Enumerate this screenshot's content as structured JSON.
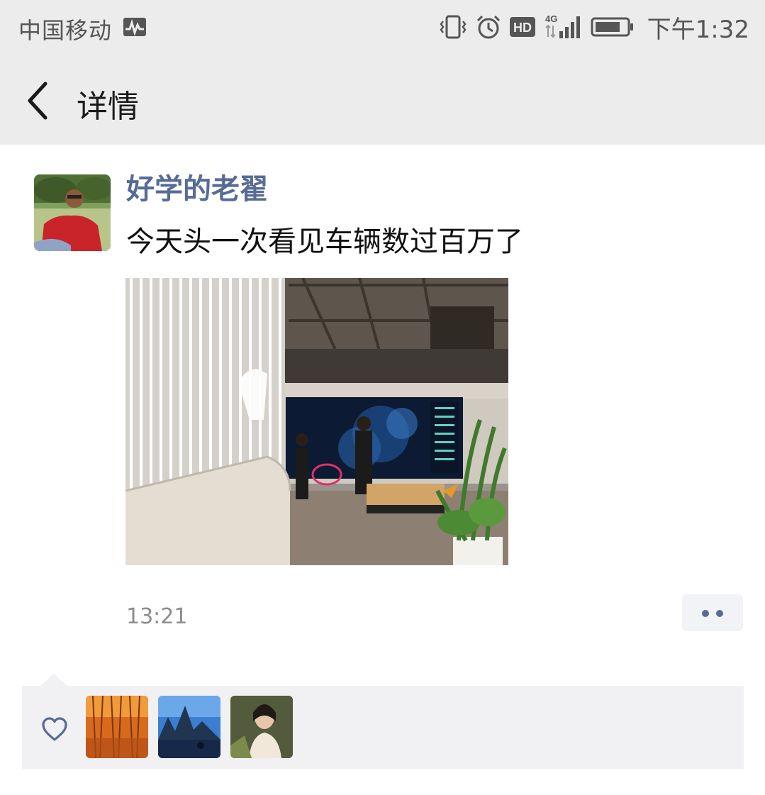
{
  "status_bar": {
    "carrier": "中国移动",
    "network_badge": "4G",
    "hd_badge": "HD",
    "time": "下午1:32",
    "icons": [
      "activity-icon",
      "vibrate-icon",
      "alarm-icon",
      "hd-icon",
      "signal-icon",
      "battery-icon"
    ]
  },
  "nav": {
    "back_icon": "chevron-left-icon",
    "title": "详情"
  },
  "post": {
    "author": "好学的老翟",
    "text": "今天头一次看见车辆数过百万了",
    "timestamp": "13:21",
    "more_icon": "more-dots-icon"
  },
  "likes": {
    "icon": "heart-outline-icon",
    "avatars": [
      "liker-avatar-1",
      "liker-avatar-2",
      "liker-avatar-3"
    ]
  },
  "colors": {
    "link_blue": "#576b95",
    "bar_bg": "#ececec",
    "panel_bg": "#f1f1f3"
  }
}
